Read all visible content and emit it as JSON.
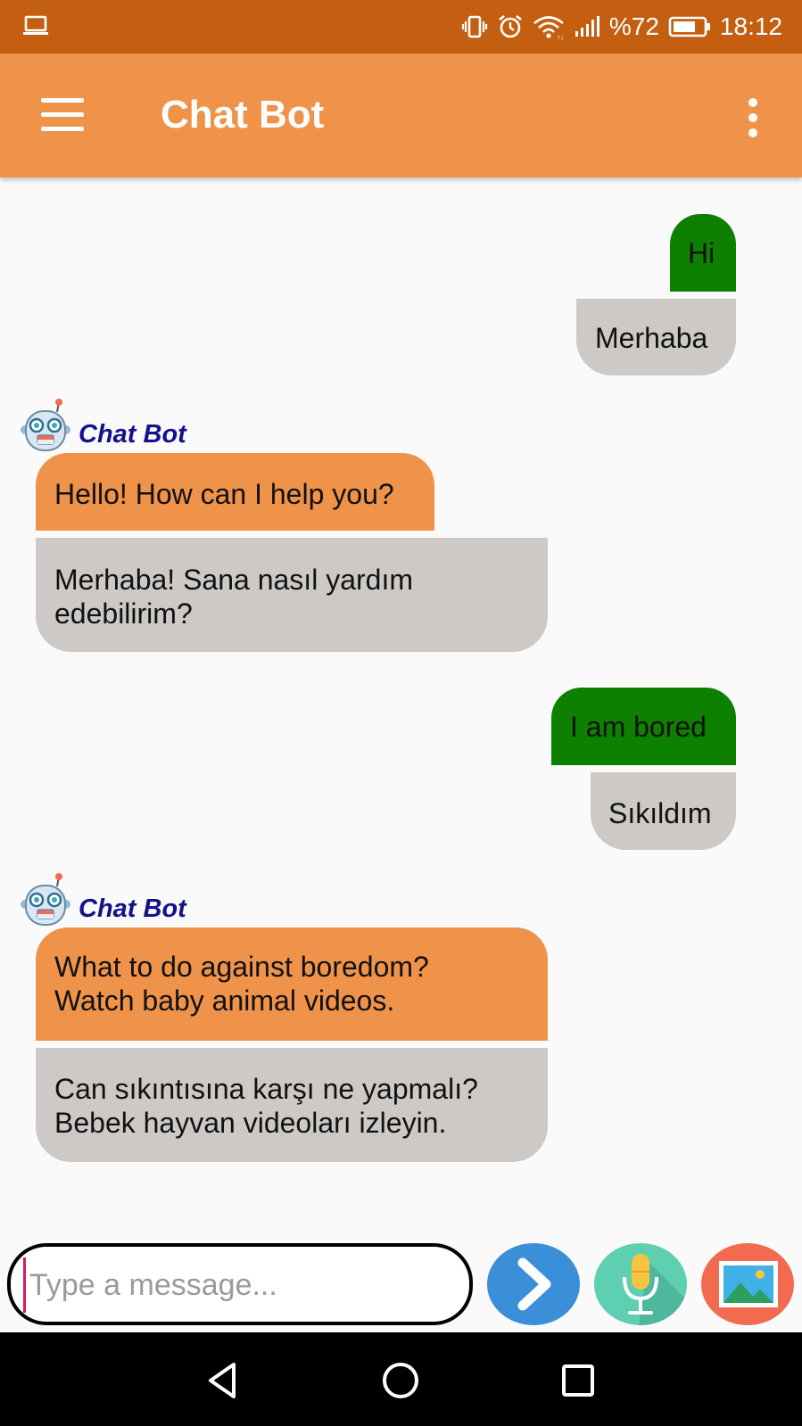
{
  "status_bar": {
    "battery": "%72",
    "time": "18:12"
  },
  "app_bar": {
    "title": "Chat Bot"
  },
  "messages": [
    {
      "sender": "user",
      "english": "Hi",
      "turkish": "Merhaba"
    },
    {
      "sender": "bot",
      "bot_name": "Chat Bot",
      "english": "Hello! How can I help you?",
      "turkish": "Merhaba! Sana nasıl yardım edebilirim?"
    },
    {
      "sender": "user",
      "english": "I am bored",
      "turkish": "Sıkıldım"
    },
    {
      "sender": "bot",
      "bot_name": "Chat Bot",
      "english": "What to do against boredom? Watch baby animal videos.",
      "turkish": "Can sıkıntısına karşı ne yapmalı? Bebek hayvan videoları izleyin."
    }
  ],
  "input": {
    "placeholder": "Type a message...",
    "value": ""
  },
  "icons": {
    "menu": "menu-icon",
    "more": "more-vert-icon",
    "send": "send-icon",
    "mic": "microphone-icon",
    "image": "image-icon",
    "bot_avatar": "robot-icon"
  },
  "colors": {
    "status_bar": "#c45f12",
    "app_bar": "#ef934b",
    "user_bubble": "#0e8000",
    "bot_bubble": "#ef934b",
    "translation_bubble": "#cdc9c6",
    "bot_name": "#14128a",
    "send_button": "#3b8fd9",
    "mic_button": "#5ecfb1",
    "image_button": "#f26b4f"
  }
}
